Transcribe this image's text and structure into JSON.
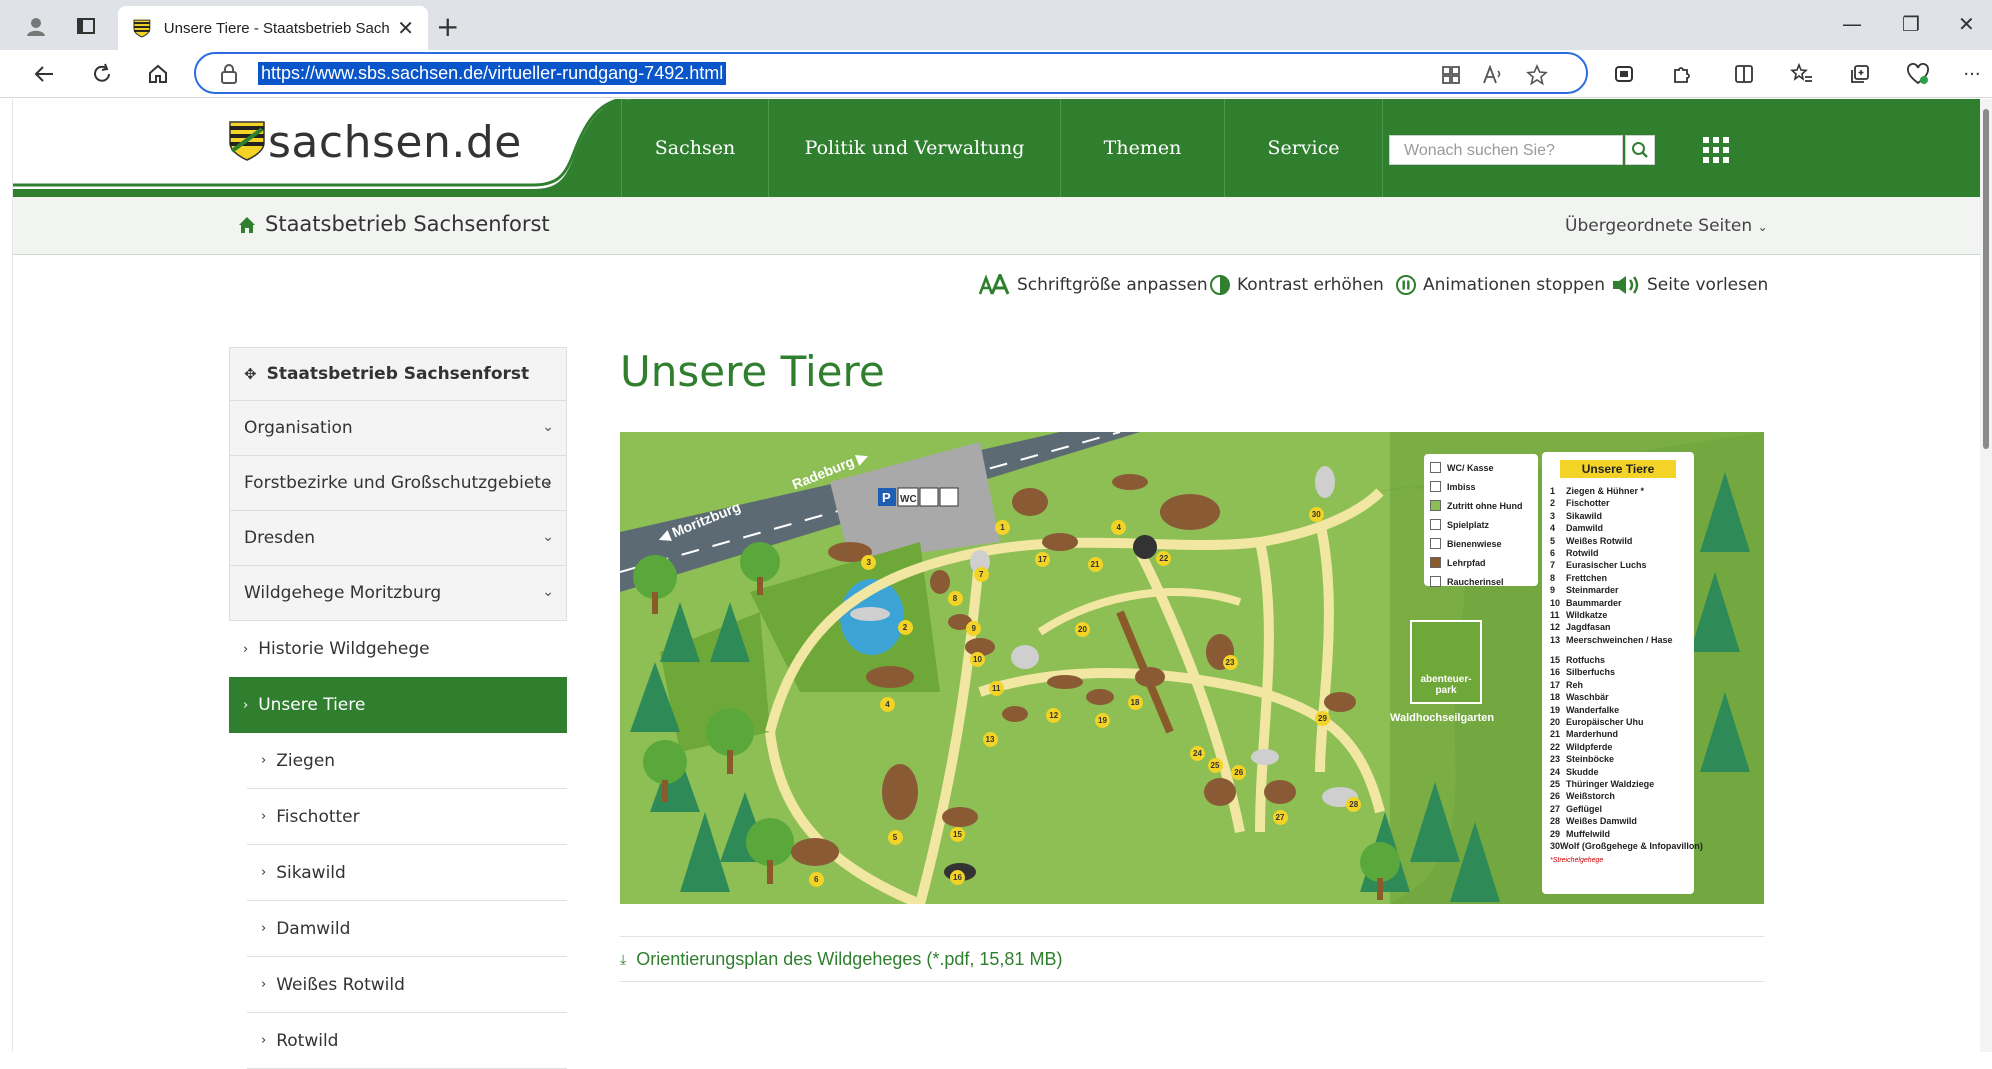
{
  "browser": {
    "tab_title": "Unsere Tiere - Staatsbetrieb Sachs",
    "url": "https://www.sbs.sachsen.de/virtueller-rundgang-7492.html",
    "new_tab": "+",
    "close_tab": "✕",
    "win_min": "—",
    "win_max": "❐",
    "win_close": "✕",
    "more": "···"
  },
  "header": {
    "logo_text": "sachsen.de",
    "nav": [
      "Sachsen",
      "Politik und Verwaltung",
      "Themen",
      "Service"
    ],
    "search_placeholder": "Wonach suchen Sie?",
    "brand_color": "#2f7f2f"
  },
  "subbar": {
    "org_name": "Staatsbetrieb Sachsenforst",
    "parent_pages": "Übergeordnete Seiten"
  },
  "a11y": {
    "font_size": "Schriftgröße anpassen",
    "contrast": "Kontrast erhöhen",
    "animations": "Animationen stoppen",
    "read_aloud": "Seite vorlesen"
  },
  "sidebar": {
    "head": "Staatsbetrieb Sachsenforst",
    "sections": [
      "Organisation",
      "Forstbezirke und Großschutzgebiete",
      "Dresden",
      "Wildgehege Moritzburg"
    ],
    "sub_items": [
      "Historie Wildgehege"
    ],
    "active": "Unsere Tiere",
    "children": [
      "Ziegen",
      "Fischotter",
      "Sikawild",
      "Damwild",
      "Weißes Rotwild",
      "Rotwild"
    ]
  },
  "main": {
    "title": "Unsere Tiere",
    "pdf_link": "Orientierungsplan des Wildgeheges (*.pdf, 15,81 MB)"
  },
  "map": {
    "roads": [
      "Moritzburg",
      "Radeburg"
    ],
    "legend1": [
      "WC/ Kasse",
      "Imbiss",
      "Zutritt ohne Hund",
      "Spielplatz",
      "Bienenwiese",
      "Lehrpfad",
      "Raucherinsel"
    ],
    "legend1_colors": [
      "#ffffff",
      "#ffffff",
      "#8dbf55",
      "#ffffff",
      "#ffffff",
      "#8b5a2b",
      "#ffffff"
    ],
    "legend_title": "Unsere Tiere",
    "animals_a": [
      "Ziegen & Hühner *",
      "Fischotter",
      "Sikawild",
      "Damwild",
      "Weißes Rotwild",
      "Rotwild",
      "Eurasischer Luchs",
      "Frettchen",
      "Steinmarder",
      "Baummarder",
      "Wildkatze",
      "Jagdfasan",
      "Meerschweinchen / Hase"
    ],
    "animals_b": [
      "Rotfuchs",
      "Silberfuchs",
      "Reh",
      "Waschbär",
      "Wanderfalke",
      "Europäischer Uhu",
      "Marderhund",
      "Wildpferde",
      "Steinböcke",
      "Skudde",
      "Thüringer Waldziege",
      "Weißstorch",
      "Geflügel",
      "Weißes Damwild",
      "Muffelwild",
      "Wolf (Großgehege & Infopavillon)"
    ],
    "animals_b_start": 15,
    "note": "*Streichelgehege",
    "park_label": "abenteuer-park",
    "park_title": "Waldhochseilgarten",
    "numbers": [
      "1",
      "2",
      "3",
      "4",
      "4",
      "5",
      "6",
      "6",
      "7",
      "8",
      "9",
      "10",
      "11",
      "12",
      "13",
      "15",
      "16",
      "17",
      "18",
      "19",
      "20",
      "21",
      "22",
      "23",
      "24",
      "25",
      "26",
      "27",
      "28",
      "29",
      "30"
    ]
  }
}
